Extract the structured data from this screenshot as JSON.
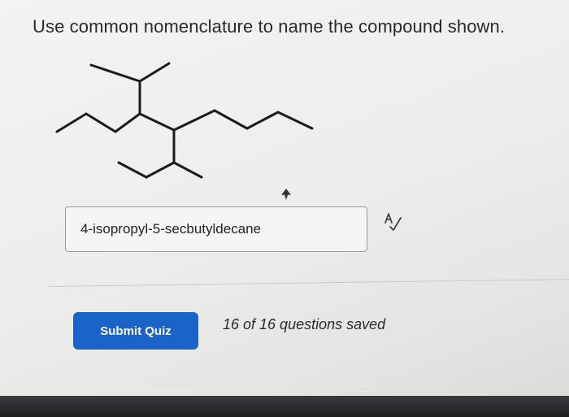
{
  "question": {
    "prompt": "Use common nomenclature to name the compound shown."
  },
  "answer": {
    "value": "4-isopropyl-5-secbutyldecane",
    "placeholder": ""
  },
  "actions": {
    "submit_label": "Submit Quiz",
    "status_text": "16 of 16 questions saved"
  },
  "icons": {
    "structure": "skeletal-structure-diagram",
    "cursor": "mouse-cursor-icon",
    "spellcheck": "spellcheck-icon"
  },
  "colors": {
    "accent": "#1a63c9",
    "text": "#2a2a2a"
  }
}
